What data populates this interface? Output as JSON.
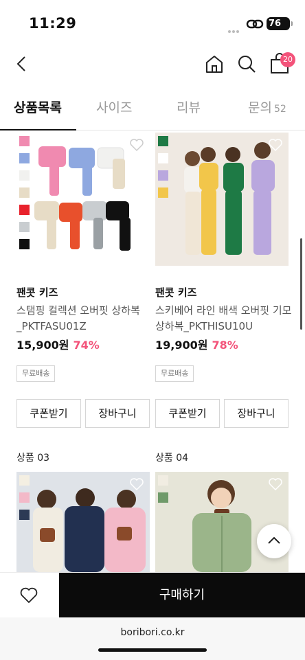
{
  "status": {
    "time": "11:29",
    "battery": "76"
  },
  "header": {
    "cart_count": "20"
  },
  "tabs": [
    {
      "label": "상품목록"
    },
    {
      "label": "사이즈"
    },
    {
      "label": "리뷰"
    },
    {
      "label": "문의",
      "count": "52"
    }
  ],
  "products": [
    {
      "brand": "팬콧 키즈",
      "name": "스탬핑 컬렉션 오버핏 상하복_PKTFASU01Z",
      "price": "15,900원",
      "discount": "74%",
      "tag": "무료배송",
      "coupon_label": "쿠폰받기",
      "cart_label": "장바구니",
      "swatches": [
        "#f08ab0",
        "#8ea8e0",
        "#f1f1ef",
        "#e7dcc6",
        "#e8222c",
        "#c9cdd0",
        "#111111"
      ]
    },
    {
      "brand": "팬콧 키즈",
      "name": "스키베어 라인 배색 오버핏 기모 상하복_PKTHISU10U",
      "price": "19,900원",
      "discount": "78%",
      "tag": "무료배송",
      "coupon_label": "쿠폰받기",
      "cart_label": "장바구니",
      "swatches": [
        "#1e7a45",
        "#ffffff",
        "#b9a7de",
        "#f2c64a"
      ]
    },
    {
      "label": "상품 03",
      "swatches": [
        "#f4efe2",
        "#f3b9c8",
        "#2c3a55"
      ]
    },
    {
      "label": "상품 04",
      "swatches": [
        "#f1ede2",
        "#6f9a6a"
      ]
    }
  ],
  "bottom": {
    "buy_label": "구매하기"
  },
  "browser": {
    "url": "boribori.co.kr"
  },
  "colors": {
    "accent": "#f3537a",
    "buy_bg": "#0b0b0b"
  }
}
